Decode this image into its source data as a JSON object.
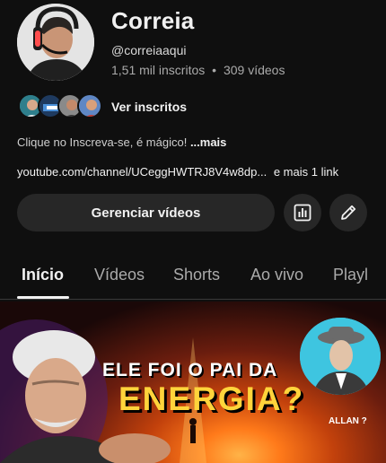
{
  "channel": {
    "name": "Correia",
    "handle": "@correiaaqui",
    "subscribers": "1,51 mil inscritos",
    "separator": "•",
    "videos": "309 vídeos"
  },
  "subscribers_row": {
    "label": "Ver inscritos"
  },
  "description": {
    "text": "Clique no Inscreva-se, é mágico! ",
    "more": "...mais"
  },
  "links": {
    "url": "youtube.com/channel/UCeggHWTRJ8V4w8dp...",
    "more": "e mais 1 link"
  },
  "actions": {
    "manage_label": "Gerenciar vídeos",
    "analytics_icon": "analytics-icon",
    "edit_icon": "pencil-icon"
  },
  "tabs": [
    {
      "label": "Início",
      "active": true
    },
    {
      "label": "Vídeos"
    },
    {
      "label": "Shorts"
    },
    {
      "label": "Ao vivo"
    },
    {
      "label": "Playl"
    }
  ],
  "thumbnail": {
    "line1": "ELE FOI O PAI DA",
    "line2": "ENERGIA?",
    "caption": "ALLAN ?"
  },
  "colors": {
    "background": "#0f0f0f",
    "button": "#272727",
    "accent_yellow": "#ffd43b"
  }
}
